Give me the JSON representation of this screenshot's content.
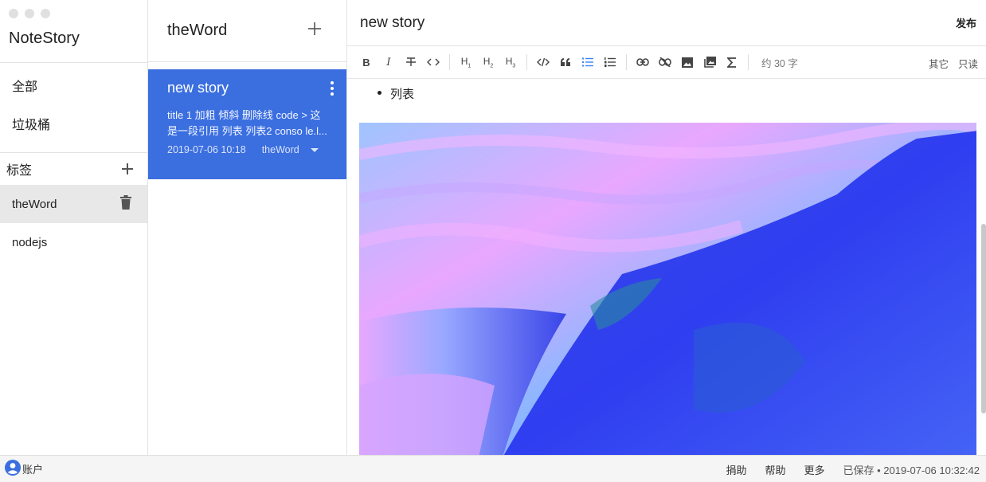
{
  "app": {
    "title": "NoteStory"
  },
  "sidebar": {
    "nav": [
      {
        "label": "全部"
      },
      {
        "label": "垃圾桶"
      }
    ],
    "tags_label": "标签",
    "tags": [
      {
        "label": "theWord",
        "active": true
      },
      {
        "label": "nodejs",
        "active": false
      }
    ]
  },
  "notes": {
    "notebook_title": "theWord",
    "items": [
      {
        "title": "new story",
        "excerpt": "title 1 加粗 倾斜 删除线 code > 这是一段引用 列表 列表2 conso le.l...",
        "date": "2019-07-06 10:18",
        "tag": "theWord"
      }
    ]
  },
  "editor": {
    "title": "new story",
    "publish_label": "发布",
    "toolbar": {
      "word_count": "约 30 字",
      "other_label": "其它",
      "readonly_label": "只读"
    },
    "content": {
      "list_item": "列表"
    }
  },
  "statusbar": {
    "account_label": "账户",
    "donate_label": "捐助",
    "help_label": "帮助",
    "more_label": "更多",
    "saved_text": "已保存 • 2019-07-06 10:32:42"
  },
  "colors": {
    "accent": "#3b6fe0",
    "active_tag_bg": "#e8e8e8",
    "list_icon_active": "#3b82f6"
  }
}
